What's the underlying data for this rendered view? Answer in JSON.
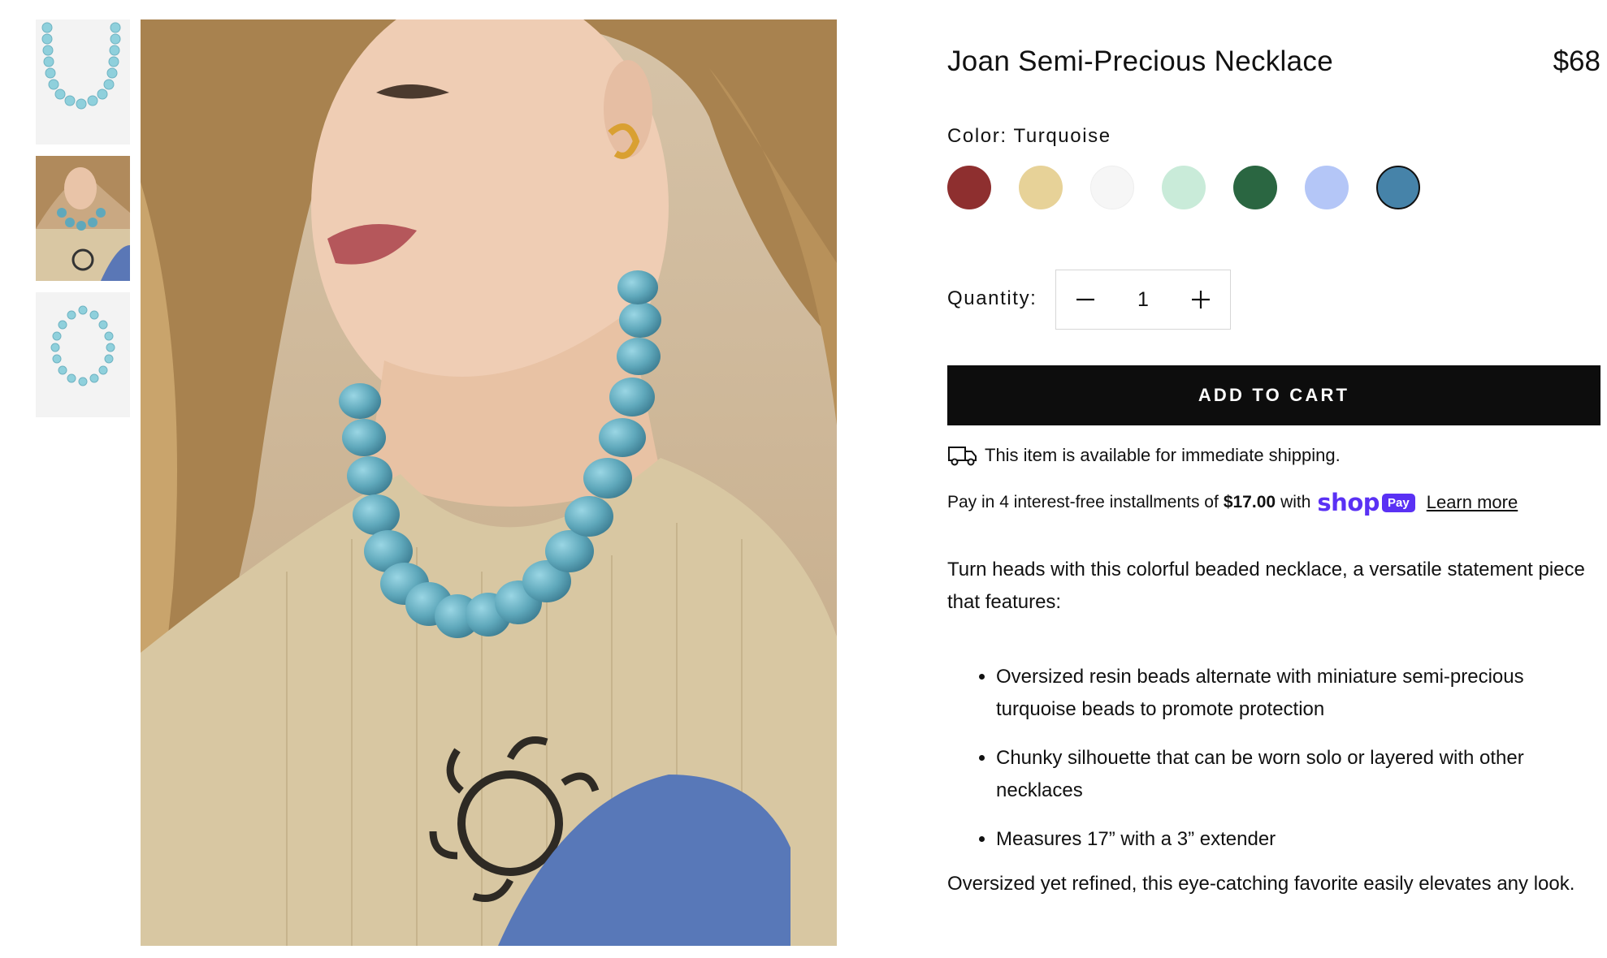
{
  "product": {
    "title": "Joan Semi-Precious Necklace",
    "price": "$68"
  },
  "color": {
    "label": "Color: Turquoise",
    "selected": "Turquoise",
    "swatches": [
      {
        "hex": "#8e2f2f"
      },
      {
        "hex": "#e7d298"
      },
      {
        "hex": "#f6f6f6"
      },
      {
        "hex": "#c9ebd9"
      },
      {
        "hex": "#2a6641"
      },
      {
        "hex": "#b4c6f7"
      },
      {
        "hex": "#4683a9"
      }
    ]
  },
  "quantity": {
    "label": "Quantity:",
    "value": "1"
  },
  "cart": {
    "add_label": "ADD TO CART"
  },
  "shipping": {
    "icon": "truck-icon",
    "text": "This item is available for immediate shipping."
  },
  "installments": {
    "prefix": "Pay in 4 interest-free installments of",
    "amount": "$17.00",
    "with": "with",
    "brand_word": "shop",
    "brand_badge": "Pay",
    "learn_more": "Learn more"
  },
  "description": {
    "intro": "Turn heads with this colorful beaded necklace, a versatile statement piece that features:",
    "bullets": [
      "Oversized resin beads alternate with miniature semi-precious turquoise beads to promote protection",
      "Chunky silhouette that can be worn solo or layered with other necklaces",
      "Measures 17” with a 3” extender"
    ],
    "closing": "Oversized yet refined, this eye-catching favorite easily elevates any look."
  },
  "accent_colors": {
    "button_bg": "#0d0d0d",
    "shop_pay": "#5a31f4",
    "bead": "#6fb8c9"
  }
}
